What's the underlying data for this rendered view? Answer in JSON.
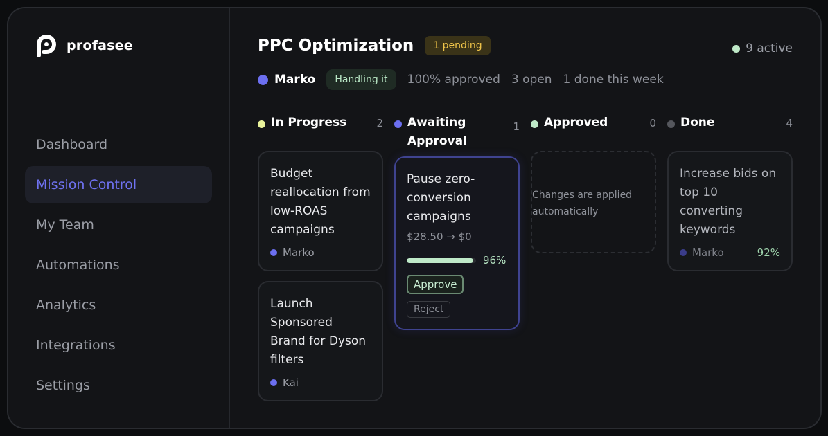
{
  "brand": {
    "name": "profasee"
  },
  "nav": [
    {
      "label": "Dashboard",
      "active": false
    },
    {
      "label": "Mission Control",
      "active": true
    },
    {
      "label": "My Team",
      "active": false
    },
    {
      "label": "Automations",
      "active": false
    },
    {
      "label": "Analytics",
      "active": false
    },
    {
      "label": "Integrations",
      "active": false
    },
    {
      "label": "Settings",
      "active": false
    }
  ],
  "header": {
    "title": "PPC Optimization",
    "pending_badge": "1 pending",
    "active_label": "9 active",
    "agent_name": "Marko",
    "agent_status": "Handling it",
    "stats": [
      "100% approved",
      "3 open",
      "1 done this week"
    ]
  },
  "colors": {
    "accent": "#6f72f2",
    "in_progress": "#e8f29a",
    "awaiting": "#6c6ff0",
    "approved": "#bfe9c8",
    "done": "#55575d",
    "active_dot": "#bfe9c8",
    "agent_marko": "#6c6ff0",
    "agent_kai": "#6c6ff0"
  },
  "columns": {
    "in_progress": {
      "title": "In Progress",
      "count": "2",
      "cards": [
        {
          "title": "Budget reallocation from low-ROAS campaigns",
          "assignee": "Marko"
        },
        {
          "title": "Launch Sponsored Brand for Dyson filters",
          "assignee": "Kai"
        }
      ]
    },
    "awaiting": {
      "title": "Awaiting Approval",
      "count": "1",
      "card": {
        "title": "Pause zero-conversion campaigns",
        "meta": "$28.50 → $0",
        "confidence": 96,
        "confidence_label": "96%",
        "approve_label": "Approve",
        "reject_label": "Reject"
      }
    },
    "approved": {
      "title": "Approved",
      "count": "0",
      "empty_text": "Changes are applied automatically"
    },
    "done": {
      "title": "Done",
      "count": "4",
      "card": {
        "title": "Increase bids on top 10 converting keywords",
        "assignee": "Marko",
        "score": "92%"
      }
    }
  }
}
